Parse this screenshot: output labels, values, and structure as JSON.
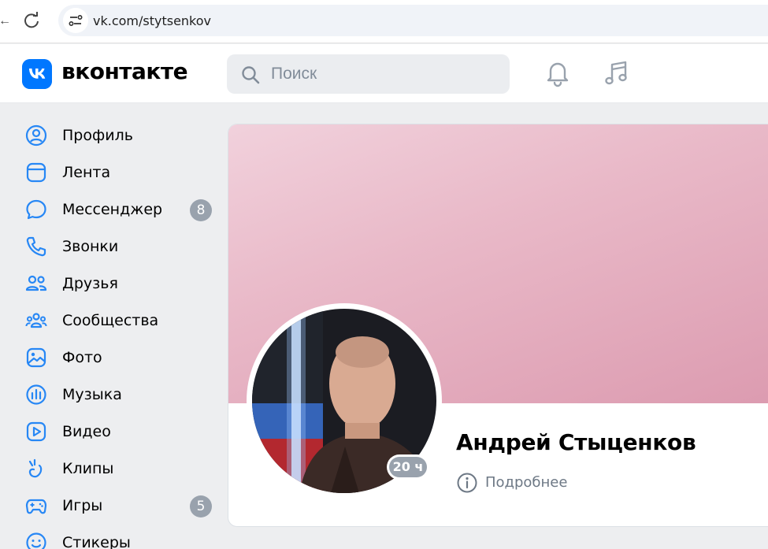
{
  "browser": {
    "url": "vk.com/stytsenkov",
    "icons": {
      "reload": "reload-icon",
      "site_info": "site-info-icon"
    }
  },
  "header": {
    "logo_text": "вконтакте",
    "search_placeholder": "Поиск",
    "icons": [
      "notifications-bell-icon",
      "music-icon"
    ]
  },
  "sidebar": {
    "items": [
      {
        "label": "Профиль",
        "icon": "profile-icon"
      },
      {
        "label": "Лента",
        "icon": "feed-icon"
      },
      {
        "label": "Мессенджер",
        "icon": "messenger-icon",
        "badge": "8"
      },
      {
        "label": "Звонки",
        "icon": "phone-icon"
      },
      {
        "label": "Друзья",
        "icon": "friends-icon"
      },
      {
        "label": "Сообщества",
        "icon": "communities-icon"
      },
      {
        "label": "Фото",
        "icon": "photo-icon"
      },
      {
        "label": "Музыка",
        "icon": "music-chart-icon"
      },
      {
        "label": "Видео",
        "icon": "video-icon"
      },
      {
        "label": "Клипы",
        "icon": "clips-icon"
      },
      {
        "label": "Игры",
        "icon": "games-icon",
        "badge": "5"
      },
      {
        "label": "Стикеры",
        "icon": "stickers-icon"
      }
    ]
  },
  "profile": {
    "name": "Андрей Стыценков",
    "story_badge": "20 ч",
    "details_label": "Подробнее"
  },
  "colors": {
    "accent": "#0077ff",
    "icon": "#2787f5",
    "badge": "#99a2ad",
    "cover_start": "#f1d1dc",
    "cover_end": "#dc9bb0"
  }
}
